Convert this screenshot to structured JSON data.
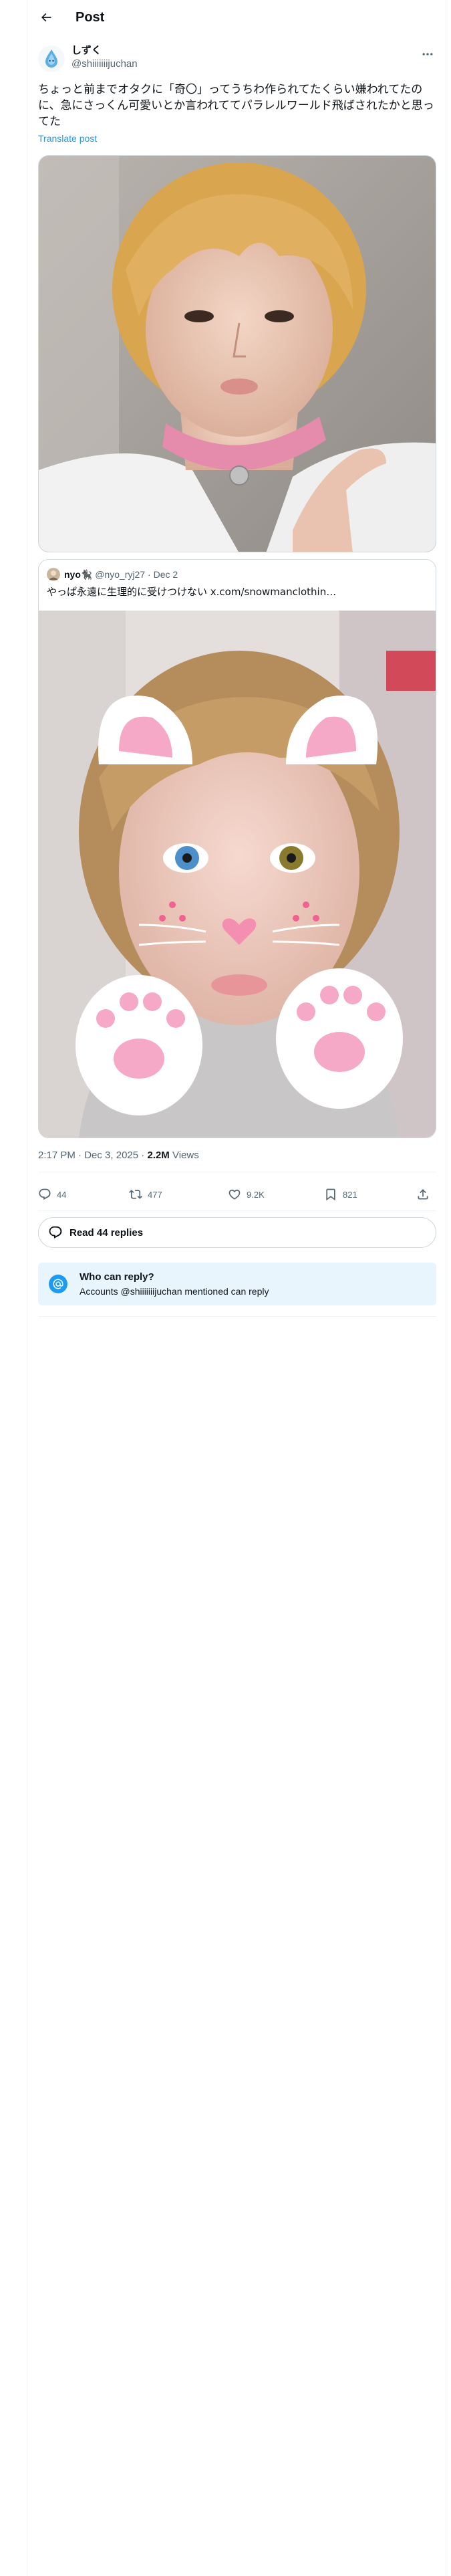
{
  "header": {
    "title": "Post",
    "back_icon": "arrow-left-icon"
  },
  "post": {
    "author_name": "しずく",
    "author_handle": "@shiiiiiiijuchan",
    "more_icon": "more-horizontal-icon",
    "text": "ちょっと前までオタクに「奇〇」ってうちわ作られてたくらい嫌われてたのに、急にさっくん可愛いとか言われててパラレルワールド飛ばされたかと思ってた",
    "translate_label": "Translate post",
    "quote": {
      "author_name": "nyo🐈‍⬛",
      "author_handle": "@nyo_ryj27",
      "date": "Dec 2",
      "text": "やっぱ永遠に生理的に受けつけない x.com/snowmanclothin…"
    },
    "time": "2:17 PM",
    "date": "Dec 3, 2025",
    "views_count": "2.2M",
    "views_label": "Views",
    "stats": {
      "replies": "44",
      "reposts": "477",
      "likes": "9.2K",
      "bookmarks": "821"
    }
  },
  "read_replies_label": "Read 44 replies",
  "who_can_reply": {
    "title": "Who can reply?",
    "description": "Accounts @shiiiiiiijuchan mentioned can reply"
  },
  "colors": {
    "accent": "#1d9bf0",
    "secondary_text": "#536471",
    "border": "#cfd9de",
    "info_bg": "#e8f5fd"
  }
}
